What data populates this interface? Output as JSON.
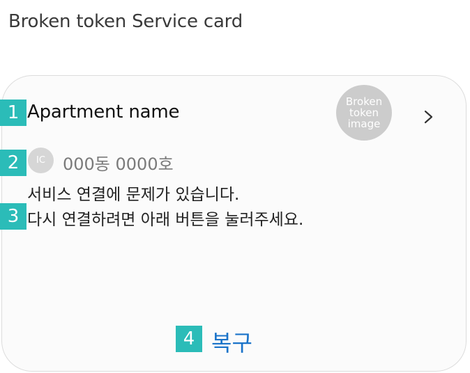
{
  "page": {
    "title": "Broken token Service card"
  },
  "card": {
    "apartment_name": "Apartment name",
    "token_image_lines": [
      "Broken",
      "token",
      "image"
    ],
    "ic_badge": "IC",
    "unit_text": "000동 0000호",
    "message_lines": [
      "서비스 연결에 문제가 있습니다.",
      "다시 연결하려면 아래 버튼을 눌러주세요."
    ],
    "recover_label": "복구"
  },
  "markers": [
    "1",
    "2",
    "3",
    "4"
  ],
  "colors": {
    "marker": "#2bbcb8",
    "action": "#1a73c9",
    "placeholder": "#cccccc"
  },
  "icons": {
    "next": "chevron-right-icon"
  }
}
